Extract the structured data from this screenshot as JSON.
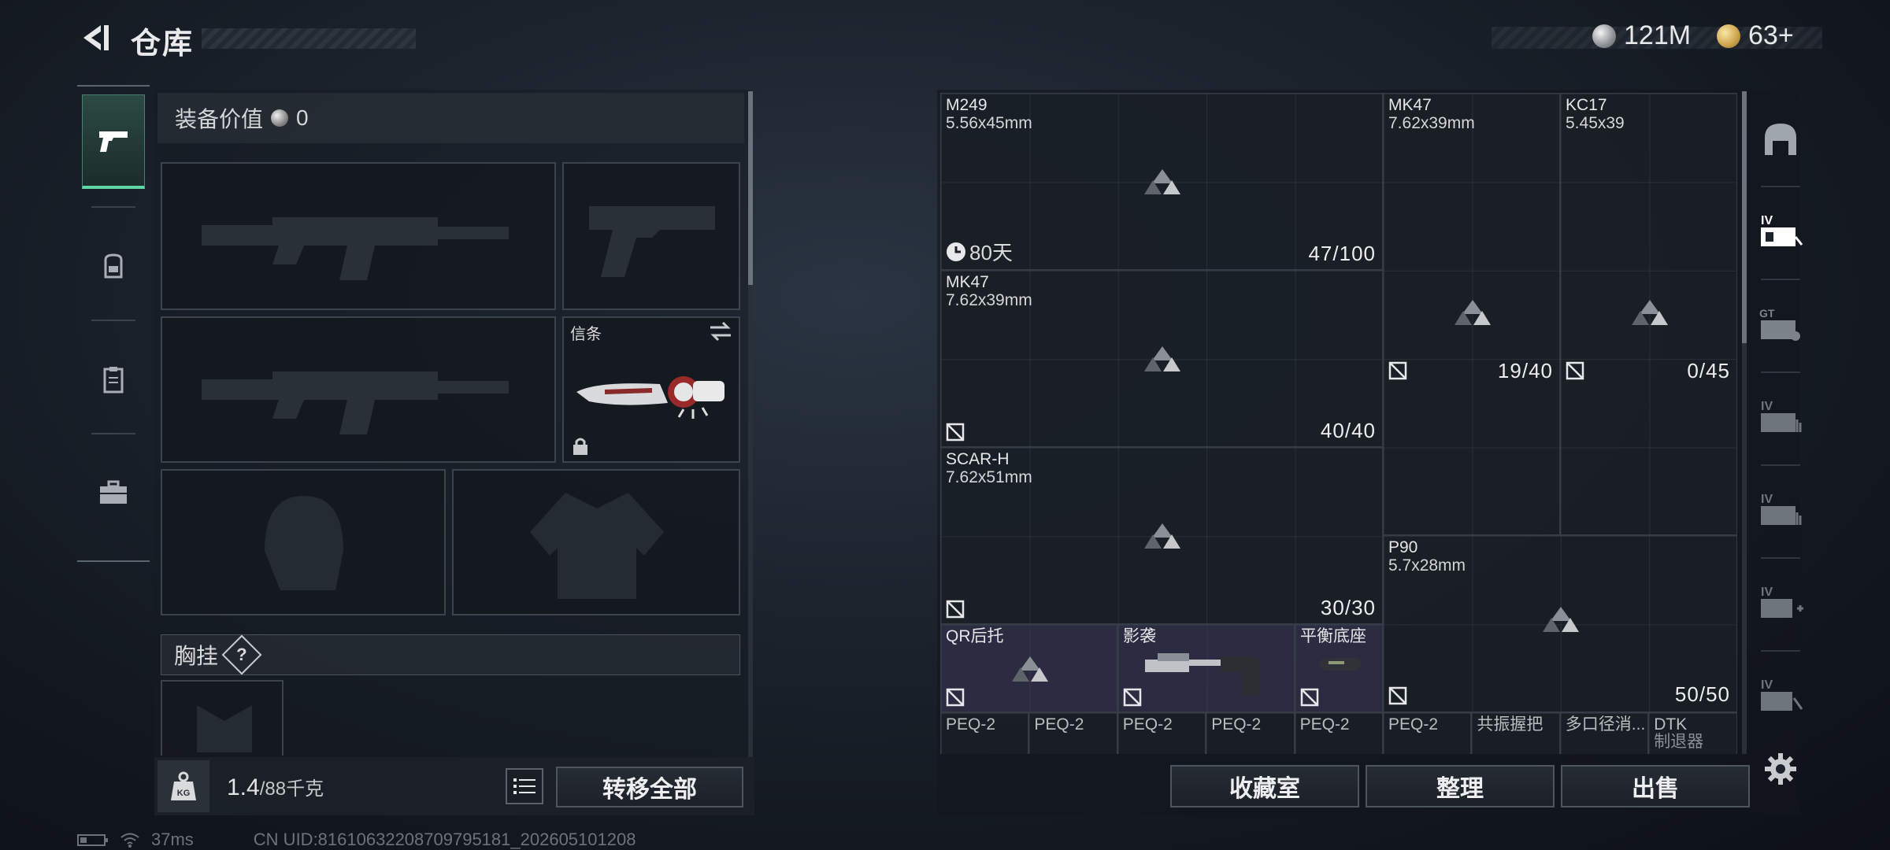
{
  "header": {
    "title": "仓库",
    "currencies": [
      {
        "name": "silver-coin",
        "value": "121M"
      },
      {
        "name": "gold-coin",
        "value": "63+"
      }
    ]
  },
  "left_tabs": [
    {
      "icon": "pistol-icon",
      "active": true
    },
    {
      "icon": "backpack-icon",
      "active": false
    },
    {
      "icon": "clipboard-icon",
      "active": false
    },
    {
      "icon": "toolbox-icon",
      "active": false
    }
  ],
  "loadout": {
    "equip_value_label": "装备价值",
    "equip_value": "0",
    "melee_slot_label": "信条",
    "vest_label": "胸挂",
    "vest_help": "?"
  },
  "footer_left": {
    "weight_value": "1.4",
    "weight_capacity": "/88千克",
    "kg_badge": "KG",
    "transfer_all_label": "转移全部"
  },
  "storage": {
    "items": [
      {
        "name": "M249",
        "caliber": "5.56x45mm",
        "count": "47/100",
        "timer": "80天"
      },
      {
        "name": "MK47",
        "caliber": "7.62x39mm",
        "count": "19/40"
      },
      {
        "name": "KC17",
        "caliber": "5.45x39",
        "count": "0/45"
      },
      {
        "name": "MK47",
        "caliber": "7.62x39mm",
        "count": "40/40"
      },
      {
        "name": "SCAR-H",
        "caliber": "7.62x51mm",
        "count": "30/30"
      },
      {
        "name": "P90",
        "caliber": "5.7x28mm",
        "count": "50/50"
      },
      {
        "name": "QR后托"
      },
      {
        "name": "影袭"
      },
      {
        "name": "平衡底座"
      }
    ],
    "bottom_row": [
      "PEQ-2",
      "PEQ-2",
      "PEQ-2",
      "PEQ-2",
      "PEQ-2",
      "PEQ-2",
      "共振握把",
      "多口径消...",
      "DTK"
    ],
    "dtk_sub": "制退器"
  },
  "footer_right": {
    "collection_label": "收藏室",
    "organize_label": "整理",
    "sell_label": "出售"
  },
  "right_tabs": [
    "dome-icon",
    "storage-iv-icon",
    "storage-gt-icon",
    "storage-iv-2-icon",
    "storage-iv-3-icon",
    "storage-iv-plus-icon",
    "storage-iv-4-icon",
    "settings-icon"
  ],
  "status_bar": {
    "ping": "37ms",
    "uid": "CN UID:81610632208709795181_202605101208"
  },
  "colors": {
    "accent_green": "#5fd6a4",
    "panel_dark": "#1a1f26",
    "border": "#4d555e"
  }
}
